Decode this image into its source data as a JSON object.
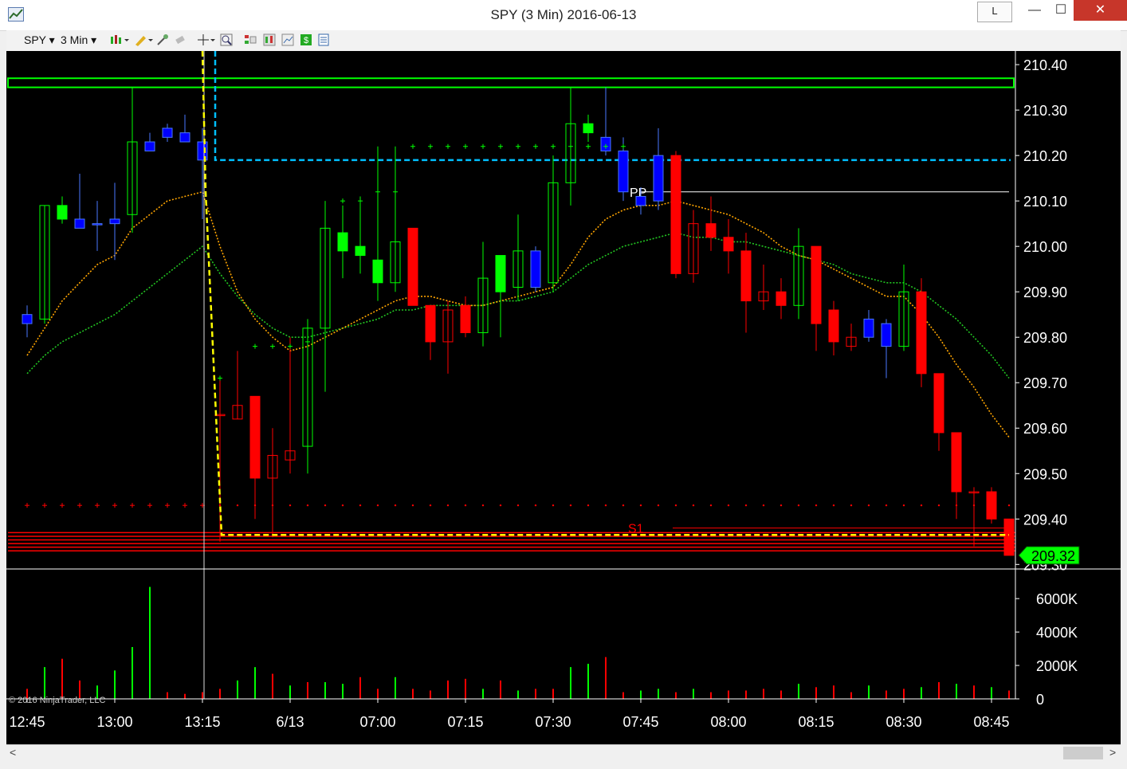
{
  "window": {
    "title": "SPY (3 Min)  2016-06-13",
    "l_button": "L",
    "minimize": "—",
    "maximize": "☐",
    "close": "✕"
  },
  "toolbar": {
    "instrument": "SPY",
    "interval": "3 Min"
  },
  "colors": {
    "up": "#00ff00",
    "down": "#ff0000",
    "neutral": "#0000ff",
    "ema_fast": "#ffa500",
    "ema_slow": "#22c522",
    "resistance": "#00ff00",
    "support": "#ff0000",
    "pivot_line": "#00bfff",
    "fib_line": "#ffff00",
    "last_price_bg": "#00ff00"
  },
  "chart_data": {
    "type": "candlestick",
    "price_axis_ticks": [
      "210.40",
      "210.30",
      "210.20",
      "210.10",
      "210.00",
      "209.90",
      "209.80",
      "209.70",
      "209.60",
      "209.50",
      "209.40",
      "209.30"
    ],
    "volume_axis_ticks": [
      "6000K",
      "4000K",
      "2000K",
      "0"
    ],
    "time_labels": [
      "12:45",
      "13:00",
      "13:15",
      "6/13",
      "07:00",
      "07:15",
      "07:30",
      "07:45",
      "08:00",
      "08:15",
      "08:30",
      "08:45"
    ],
    "last_price": "209.32",
    "pivot_labels": [
      "PP",
      "S1"
    ],
    "levels": {
      "PP": 210.12,
      "S1": 209.38,
      "resistance_band": [
        210.35,
        210.37
      ],
      "pivot_dashed": 210.19,
      "support_band": [
        209.33,
        209.37
      ],
      "prior_close_marks": 209.43
    },
    "ylim": [
      209.29,
      210.43
    ],
    "candles": [
      {
        "o": 209.83,
        "h": 209.87,
        "l": 209.8,
        "c": 209.85,
        "k": "blue"
      },
      {
        "o": 209.84,
        "h": 210.09,
        "l": 209.83,
        "c": 210.09,
        "k": "up_hollow"
      },
      {
        "o": 210.09,
        "h": 210.11,
        "l": 210.05,
        "c": 210.06,
        "k": "up_fill"
      },
      {
        "o": 210.06,
        "h": 210.16,
        "l": 210.04,
        "c": 210.04,
        "k": "blue"
      },
      {
        "o": 210.05,
        "h": 210.1,
        "l": 209.99,
        "c": 210.05,
        "k": "blue"
      },
      {
        "o": 210.05,
        "h": 210.14,
        "l": 209.97,
        "c": 210.06,
        "k": "blue"
      },
      {
        "o": 210.07,
        "h": 210.35,
        "l": 210.03,
        "c": 210.23,
        "k": "up_hollow"
      },
      {
        "o": 210.23,
        "h": 210.25,
        "l": 210.21,
        "c": 210.21,
        "k": "blue"
      },
      {
        "o": 210.24,
        "h": 210.27,
        "l": 210.23,
        "c": 210.26,
        "k": "blue"
      },
      {
        "o": 210.25,
        "h": 210.29,
        "l": 210.24,
        "c": 210.23,
        "k": "blue"
      },
      {
        "o": 210.23,
        "h": 210.26,
        "l": 210.06,
        "c": 210.19,
        "k": "blue"
      },
      {
        "o": 209.63,
        "h": 209.71,
        "l": 209.35,
        "c": 209.63,
        "k": "down_hollow"
      },
      {
        "o": 209.65,
        "h": 209.77,
        "l": 209.62,
        "c": 209.62,
        "k": "down_hollow"
      },
      {
        "o": 209.67,
        "h": 209.67,
        "l": 209.4,
        "c": 209.49,
        "k": "down_fill"
      },
      {
        "o": 209.54,
        "h": 209.6,
        "l": 209.36,
        "c": 209.49,
        "k": "down_hollow"
      },
      {
        "o": 209.55,
        "h": 209.8,
        "l": 209.5,
        "c": 209.53,
        "k": "down_hollow"
      },
      {
        "o": 209.56,
        "h": 209.84,
        "l": 209.5,
        "c": 209.82,
        "k": "up_hollow"
      },
      {
        "o": 209.82,
        "h": 210.1,
        "l": 209.68,
        "c": 210.04,
        "k": "up_hollow"
      },
      {
        "o": 209.99,
        "h": 210.09,
        "l": 209.93,
        "c": 210.03,
        "k": "up_fill"
      },
      {
        "o": 210.0,
        "h": 210.11,
        "l": 209.94,
        "c": 209.98,
        "k": "up_fill"
      },
      {
        "o": 209.97,
        "h": 210.22,
        "l": 209.88,
        "c": 209.92,
        "k": "up_fill"
      },
      {
        "o": 209.92,
        "h": 210.22,
        "l": 209.9,
        "c": 210.01,
        "k": "up_hollow"
      },
      {
        "o": 210.04,
        "h": 210.04,
        "l": 209.87,
        "c": 209.87,
        "k": "down_fill"
      },
      {
        "o": 209.87,
        "h": 209.87,
        "l": 209.75,
        "c": 209.79,
        "k": "down_fill"
      },
      {
        "o": 209.86,
        "h": 209.88,
        "l": 209.72,
        "c": 209.79,
        "k": "down_hollow"
      },
      {
        "o": 209.87,
        "h": 209.89,
        "l": 209.8,
        "c": 209.81,
        "k": "down_fill"
      },
      {
        "o": 209.81,
        "h": 210.01,
        "l": 209.78,
        "c": 209.93,
        "k": "up_hollow"
      },
      {
        "o": 209.9,
        "h": 209.98,
        "l": 209.8,
        "c": 209.98,
        "k": "up_fill"
      },
      {
        "o": 209.91,
        "h": 210.07,
        "l": 209.88,
        "c": 209.99,
        "k": "up_hollow"
      },
      {
        "o": 209.91,
        "h": 210.0,
        "l": 209.9,
        "c": 209.99,
        "k": "blue"
      },
      {
        "o": 209.92,
        "h": 210.2,
        "l": 209.9,
        "c": 210.14,
        "k": "up_hollow"
      },
      {
        "o": 210.14,
        "h": 210.35,
        "l": 210.09,
        "c": 210.27,
        "k": "up_hollow"
      },
      {
        "o": 210.27,
        "h": 210.29,
        "l": 210.23,
        "c": 210.25,
        "k": "up_fill"
      },
      {
        "o": 210.24,
        "h": 210.35,
        "l": 210.2,
        "c": 210.21,
        "k": "blue"
      },
      {
        "o": 210.21,
        "h": 210.24,
        "l": 210.1,
        "c": 210.12,
        "k": "blue"
      },
      {
        "o": 210.11,
        "h": 210.13,
        "l": 210.07,
        "c": 210.09,
        "k": "blue"
      },
      {
        "o": 210.1,
        "h": 210.26,
        "l": 210.08,
        "c": 210.2,
        "k": "blue"
      },
      {
        "o": 210.2,
        "h": 210.21,
        "l": 209.93,
        "c": 209.94,
        "k": "down_fill"
      },
      {
        "o": 210.05,
        "h": 210.08,
        "l": 209.92,
        "c": 209.94,
        "k": "down_hollow"
      },
      {
        "o": 210.05,
        "h": 210.11,
        "l": 209.99,
        "c": 210.02,
        "k": "down_fill"
      },
      {
        "o": 210.02,
        "h": 210.06,
        "l": 209.94,
        "c": 209.99,
        "k": "down_fill"
      },
      {
        "o": 209.99,
        "h": 210.03,
        "l": 209.81,
        "c": 209.88,
        "k": "down_fill"
      },
      {
        "o": 209.9,
        "h": 209.96,
        "l": 209.86,
        "c": 209.88,
        "k": "down_hollow"
      },
      {
        "o": 209.9,
        "h": 209.93,
        "l": 209.84,
        "c": 209.87,
        "k": "down_fill"
      },
      {
        "o": 209.87,
        "h": 210.04,
        "l": 209.84,
        "c": 210.0,
        "k": "up_hollow"
      },
      {
        "o": 210.0,
        "h": 210.0,
        "l": 209.77,
        "c": 209.83,
        "k": "down_fill"
      },
      {
        "o": 209.86,
        "h": 209.88,
        "l": 209.76,
        "c": 209.79,
        "k": "down_fill"
      },
      {
        "o": 209.8,
        "h": 209.83,
        "l": 209.77,
        "c": 209.78,
        "k": "down_hollow"
      },
      {
        "o": 209.8,
        "h": 209.86,
        "l": 209.79,
        "c": 209.84,
        "k": "blue"
      },
      {
        "o": 209.83,
        "h": 209.84,
        "l": 209.71,
        "c": 209.78,
        "k": "blue"
      },
      {
        "o": 209.78,
        "h": 209.96,
        "l": 209.77,
        "c": 209.9,
        "k": "up_hollow"
      },
      {
        "o": 209.9,
        "h": 209.93,
        "l": 209.69,
        "c": 209.72,
        "k": "down_fill"
      },
      {
        "o": 209.72,
        "h": 209.72,
        "l": 209.55,
        "c": 209.59,
        "k": "down_fill"
      },
      {
        "o": 209.59,
        "h": 209.59,
        "l": 209.4,
        "c": 209.46,
        "k": "down_fill"
      },
      {
        "o": 209.46,
        "h": 209.47,
        "l": 209.34,
        "c": 209.46,
        "k": "down_hollow"
      },
      {
        "o": 209.46,
        "h": 209.47,
        "l": 209.39,
        "c": 209.4,
        "k": "down_fill"
      },
      {
        "o": 209.4,
        "h": 209.4,
        "l": 209.32,
        "c": 209.32,
        "k": "down_fill"
      }
    ],
    "ema_fast": [
      209.76,
      209.82,
      209.88,
      209.92,
      209.96,
      209.98,
      210.04,
      210.07,
      210.1,
      210.11,
      210.12,
      210.0,
      209.9,
      209.84,
      209.8,
      209.77,
      209.78,
      209.8,
      209.82,
      209.84,
      209.86,
      209.88,
      209.89,
      209.89,
      209.88,
      209.87,
      209.87,
      209.88,
      209.89,
      209.9,
      209.91,
      209.96,
      210.02,
      210.06,
      210.08,
      210.09,
      210.09,
      210.1,
      210.09,
      210.08,
      210.07,
      210.05,
      210.03,
      210.0,
      209.98,
      209.97,
      209.95,
      209.93,
      209.91,
      209.89,
      209.89,
      209.85,
      209.8,
      209.74,
      209.69,
      209.63,
      209.58
    ],
    "ema_slow": [
      209.72,
      209.76,
      209.79,
      209.81,
      209.83,
      209.85,
      209.88,
      209.91,
      209.94,
      209.97,
      210.0,
      209.94,
      209.89,
      209.85,
      209.82,
      209.8,
      209.8,
      209.81,
      209.82,
      209.83,
      209.84,
      209.86,
      209.86,
      209.87,
      209.87,
      209.87,
      209.87,
      209.88,
      209.88,
      209.89,
      209.9,
      209.93,
      209.96,
      209.98,
      210.0,
      210.01,
      210.02,
      210.03,
      210.02,
      210.02,
      210.01,
      210.01,
      210.0,
      209.99,
      209.98,
      209.97,
      209.96,
      209.94,
      209.93,
      209.92,
      209.92,
      209.9,
      209.87,
      209.84,
      209.8,
      209.76,
      209.71
    ],
    "volume_k": [
      600,
      1900,
      2400,
      1100,
      800,
      1700,
      3100,
      6700,
      400,
      300,
      400,
      600,
      1100,
      1900,
      1500,
      800,
      1000,
      1000,
      900,
      1300,
      600,
      1300,
      600,
      500,
      1100,
      1200,
      600,
      1100,
      500,
      600,
      600,
      1900,
      2100,
      2500,
      400,
      500,
      600,
      400,
      600,
      400,
      500,
      500,
      600,
      500,
      900,
      700,
      800,
      400,
      800,
      500,
      600,
      700,
      1000,
      900,
      800,
      700,
      500
    ],
    "volume_up": [
      false,
      true,
      false,
      false,
      true,
      true,
      true,
      true,
      false,
      false,
      false,
      false,
      true,
      true,
      false,
      true,
      false,
      true,
      true,
      false,
      false,
      true,
      false,
      false,
      false,
      false,
      true,
      false,
      true,
      false,
      false,
      true,
      true,
      false,
      false,
      true,
      true,
      false,
      true,
      false,
      false,
      false,
      false,
      false,
      true,
      false,
      false,
      false,
      true,
      false,
      false,
      true,
      false,
      true,
      false,
      true,
      false
    ]
  },
  "copyright": "© 2016 NinjaTrader, LLC"
}
